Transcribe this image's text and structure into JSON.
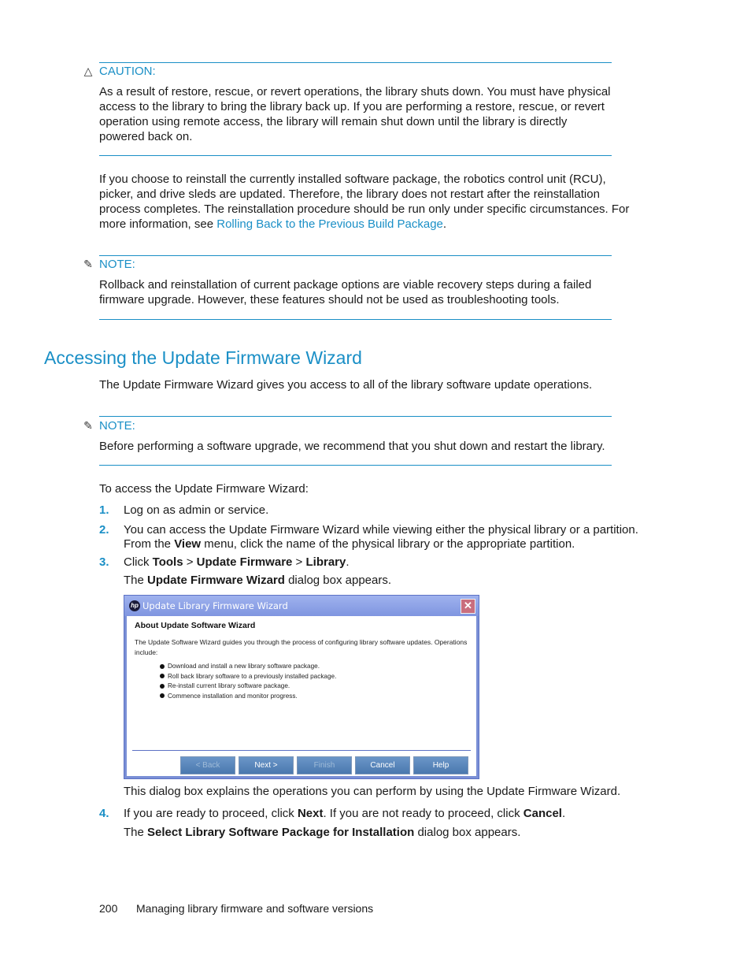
{
  "caution": {
    "icon": "warning-triangle-icon",
    "label": "CAUTION:",
    "text": "As a result of restore, rescue, or revert operations, the library shuts down. You must have physical access to the library to bring the library back up. If you are performing a restore, rescue, or revert operation using remote access, the library will remain shut down until the library is directly powered back on."
  },
  "reinstall_paragraph": {
    "text": "If you choose to reinstall the currently installed software package, the robotics control unit (RCU), picker, and drive sleds are updated. Therefore, the library does not restart after the reinstallation process completes. The reinstallation procedure should be run only under specific circumstances. For more information, see ",
    "link": "Rolling Back to the Previous Build Package",
    "after": "."
  },
  "note1": {
    "icon": "note-icon",
    "label": "NOTE:",
    "text": "Rollback and reinstallation of current package options are viable recovery steps during a failed firmware upgrade. However, these features should not be used as troubleshooting tools."
  },
  "section": {
    "title": "Accessing the Update Firmware Wizard",
    "intro": "The Update Firmware Wizard gives you access to all of the library software update operations."
  },
  "note2": {
    "icon": "note-icon",
    "label": "NOTE:",
    "text": "Before performing a software upgrade, we recommend that you shut down and restart the library."
  },
  "procedure": {
    "lead": "To access the Update Firmware Wizard:",
    "steps": [
      {
        "num": "1.",
        "text": "Log on as admin or service."
      },
      {
        "num": "2.",
        "a": "You can access the Update Firmware Wizard while viewing either the physical library or a partition. From the ",
        "b1": "View",
        "c": " menu, click the name of the physical library or the appropriate partition."
      },
      {
        "num": "3.",
        "a": "Click ",
        "b1": "Tools",
        "s1": " > ",
        "b2": "Update Firmware",
        "s2": " > ",
        "b3": "Library",
        "end": ".",
        "result_a": "The ",
        "result_b": "Update Firmware Wizard",
        "result_c": " dialog box appears."
      },
      {
        "num": "4.",
        "a": "If you are ready to proceed, click ",
        "b1": "Next",
        "c": ". If you are not ready to proceed, click ",
        "b2": "Cancel",
        "end": ".",
        "result_a": "The ",
        "result_b": "Select Library Software Package for Installation",
        "result_c": " dialog box appears."
      }
    ],
    "dialog_caption": "This dialog box explains the operations you can perform by using the Update Firmware Wizard."
  },
  "dialog": {
    "title": "Update Library Firmware Wizard",
    "logo": "hp",
    "close_glyph": "✕",
    "heading": "About Update Software Wizard",
    "description": "The Update Software Wizard guides you through the process of configuring library software updates. Operations include:",
    "bullets": [
      "Download and install a new library software package.",
      "Roll back library software to a previously installed package.",
      "Re-install current library software package.",
      "Commence installation and monitor progress."
    ],
    "buttons": {
      "back": "< Back",
      "next": "Next >",
      "finish": "Finish",
      "cancel": "Cancel",
      "help": "Help"
    }
  },
  "footer": {
    "page_number": "200",
    "chapter_title": "Managing library firmware and software versions"
  }
}
